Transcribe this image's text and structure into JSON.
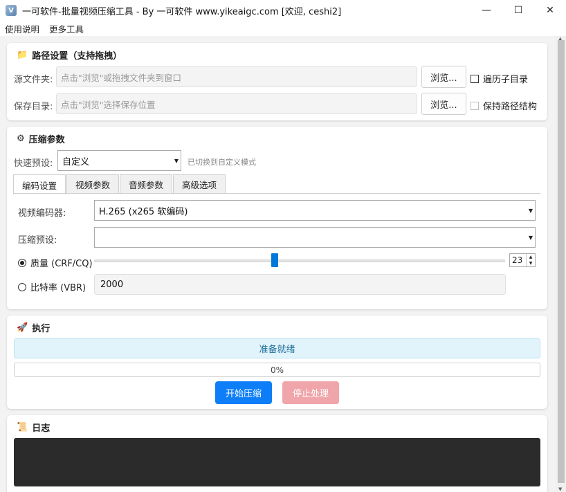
{
  "window": {
    "title": "一可软件-批量视频压缩工具 - By 一可软件 www.yikeaigc.com [欢迎, ceshi2]",
    "controls": {
      "minimize": "—",
      "maximize": "☐",
      "close": "✕"
    }
  },
  "menu": [
    "使用说明",
    "更多工具"
  ],
  "path_settings": {
    "title": "路径设置（支持拖拽）",
    "source_label": "源文件夹:",
    "source_placeholder": "点击\"浏览\"或拖拽文件夹到窗口",
    "save_label": "保存目录:",
    "save_placeholder": "点击\"浏览\"选择保存位置",
    "browse": "浏览...",
    "recurse_label": "遍历子目录",
    "recurse_checked": false,
    "keep_structure_label": "保持路径结构",
    "keep_structure_checked": false
  },
  "compress_params": {
    "title": "压缩参数",
    "preset_label": "快速预设:",
    "preset_value": "自定义",
    "preset_hint": "已切换到自定义模式",
    "tabs": [
      "编码设置",
      "视频参数",
      "音频参数",
      "高级选项"
    ],
    "active_tab": 0,
    "encoder_label": "视频编码器:",
    "encoder_value": "H.265 (x265 软编码)",
    "compress_preset_label": "压缩预设:",
    "compress_preset_value": "",
    "quality_label": "质量 (CRF/CQ)",
    "quality_selected": true,
    "quality_value": "23",
    "quality_slider_fraction": 0.44,
    "bitrate_label": "比特率 (VBR)",
    "bitrate_selected": false,
    "bitrate_value": "2000"
  },
  "execute": {
    "title": "执行",
    "status": "准备就绪",
    "progress_text": "0%",
    "progress_fraction": 0,
    "start_button": "开始压缩",
    "stop_button": "停止处理"
  },
  "log": {
    "title": "日志"
  },
  "colors": {
    "accent": "#0078d7",
    "start_button": "#0d7ef8",
    "stop_button_disabled": "#f0a5aa",
    "status_bg": "#e1f3fb",
    "log_bg": "#2b2b2b"
  }
}
